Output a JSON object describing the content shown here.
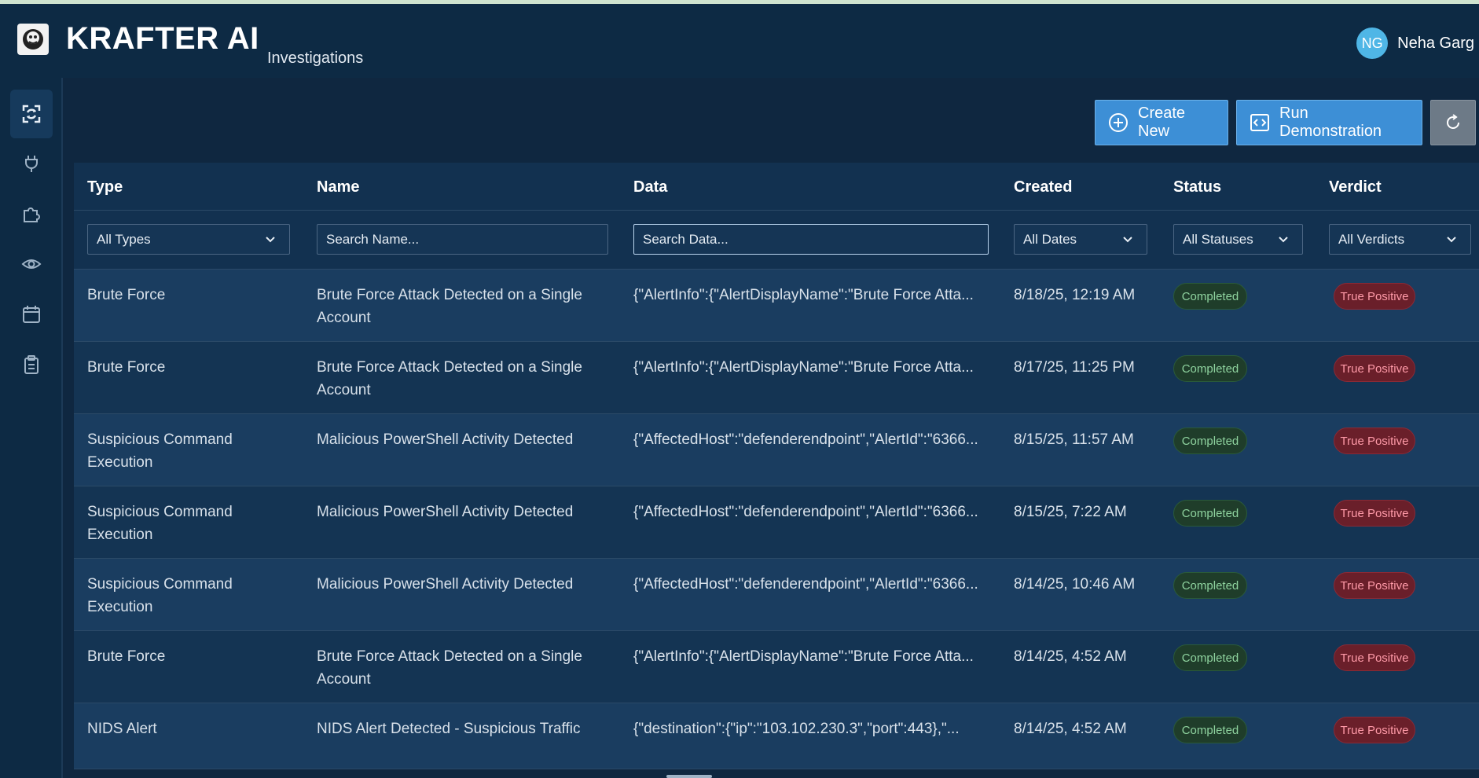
{
  "app": {
    "brand": "KRAFTER AI",
    "breadcrumb": "Investigations"
  },
  "user": {
    "initials": "NG",
    "name": "Neha Garg"
  },
  "toolbar": {
    "create_label": "Create New",
    "demo_label": "Run Demonstration"
  },
  "columns": {
    "type": "Type",
    "name": "Name",
    "data": "Data",
    "created": "Created",
    "status": "Status",
    "verdict": "Verdict"
  },
  "filters": {
    "type": "All Types",
    "name_placeholder": "Search Name...",
    "data_placeholder": "Search Data...",
    "dates": "All Dates",
    "statuses": "All Statuses",
    "verdicts": "All Verdicts"
  },
  "rows": [
    {
      "type": "Brute Force",
      "name": "Brute Force Attack Detected on a Single Account",
      "data": "{\"AlertInfo\":{\"AlertDisplayName\":\"Brute Force Atta...",
      "created": "8/18/25, 12:19 AM",
      "status": "Completed",
      "verdict": "True Positive"
    },
    {
      "type": "Brute Force",
      "name": "Brute Force Attack Detected on a Single Account",
      "data": "{\"AlertInfo\":{\"AlertDisplayName\":\"Brute Force Atta...",
      "created": "8/17/25, 11:25 PM",
      "status": "Completed",
      "verdict": "True Positive"
    },
    {
      "type": "Suspicious Command Execution",
      "name": "Malicious PowerShell Activity Detected",
      "data": "{\"AffectedHost\":\"defenderendpoint\",\"AlertId\":\"6366...",
      "created": "8/15/25, 11:57 AM",
      "status": "Completed",
      "verdict": "True Positive"
    },
    {
      "type": "Suspicious Command Execution",
      "name": "Malicious PowerShell Activity Detected",
      "data": "{\"AffectedHost\":\"defenderendpoint\",\"AlertId\":\"6366...",
      "created": "8/15/25, 7:22 AM",
      "status": "Completed",
      "verdict": "True Positive"
    },
    {
      "type": "Suspicious Command Execution",
      "name": "Malicious PowerShell Activity Detected",
      "data": "{\"AffectedHost\":\"defenderendpoint\",\"AlertId\":\"6366...",
      "created": "8/14/25, 10:46 AM",
      "status": "Completed",
      "verdict": "True Positive"
    },
    {
      "type": "Brute Force",
      "name": "Brute Force Attack Detected on a Single Account",
      "data": "{\"AlertInfo\":{\"AlertDisplayName\":\"Brute Force Atta...",
      "created": "8/14/25, 4:52 AM",
      "status": "Completed",
      "verdict": "True Positive"
    },
    {
      "type": "NIDS Alert",
      "name": "NIDS Alert Detected - Suspicious Traffic",
      "data": "{\"destination\":{\"ip\":\"103.102.230.3\",\"port\":443},\"...",
      "created": "8/14/25, 4:52 AM",
      "status": "Completed",
      "verdict": "True Positive"
    }
  ],
  "sidebar_icons": [
    "investigations-icon",
    "plug-icon",
    "puzzle-icon",
    "eye-icon",
    "calendar-icon",
    "clipboard-icon"
  ],
  "colors": {
    "accent": "#3d8fd6",
    "status_ok": "#8fd39f",
    "verdict_tp": "#ff9aa8"
  }
}
